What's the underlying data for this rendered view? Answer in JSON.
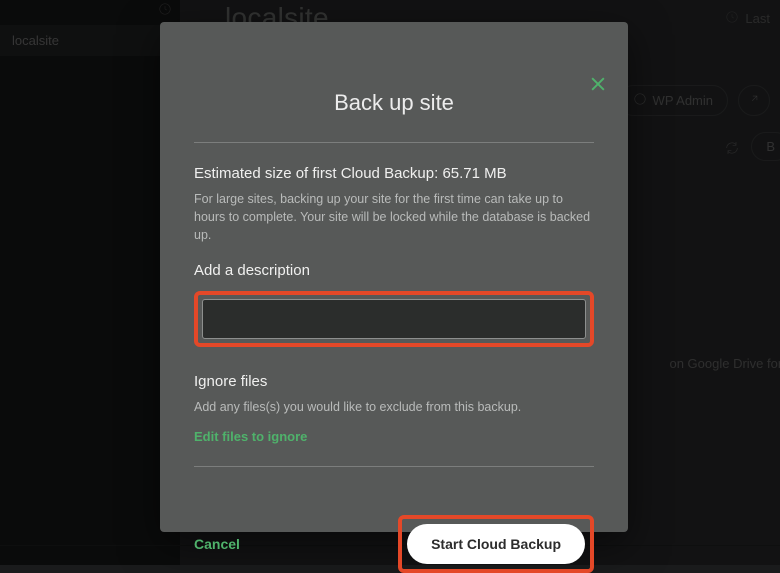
{
  "background": {
    "sidebar_site": "localsite",
    "site_name": "localsite",
    "site_menu_dots": "···",
    "last_started_label": "Last",
    "wp_admin_label": "WP Admin",
    "back_pill_text": "B",
    "drive_note": "on Google Drive for this site y"
  },
  "modal": {
    "title": "Back up site",
    "size": {
      "heading": "Estimated size of first Cloud Backup: 65.71 MB",
      "sub": "For large sites, backing up your site for the first time can take up to hours to complete. Your site will be locked while the database is backed up."
    },
    "description": {
      "heading": "Add a description",
      "value": ""
    },
    "ignore": {
      "heading": "Ignore files",
      "sub": "Add any files(s) you would like to exclude from this backup.",
      "link": "Edit files to ignore"
    },
    "actions": {
      "cancel": "Cancel",
      "start": "Start Cloud Backup"
    }
  },
  "colors": {
    "accent_green": "#4fb26b",
    "highlight_red": "#e44828",
    "modal_bg": "#575958"
  }
}
